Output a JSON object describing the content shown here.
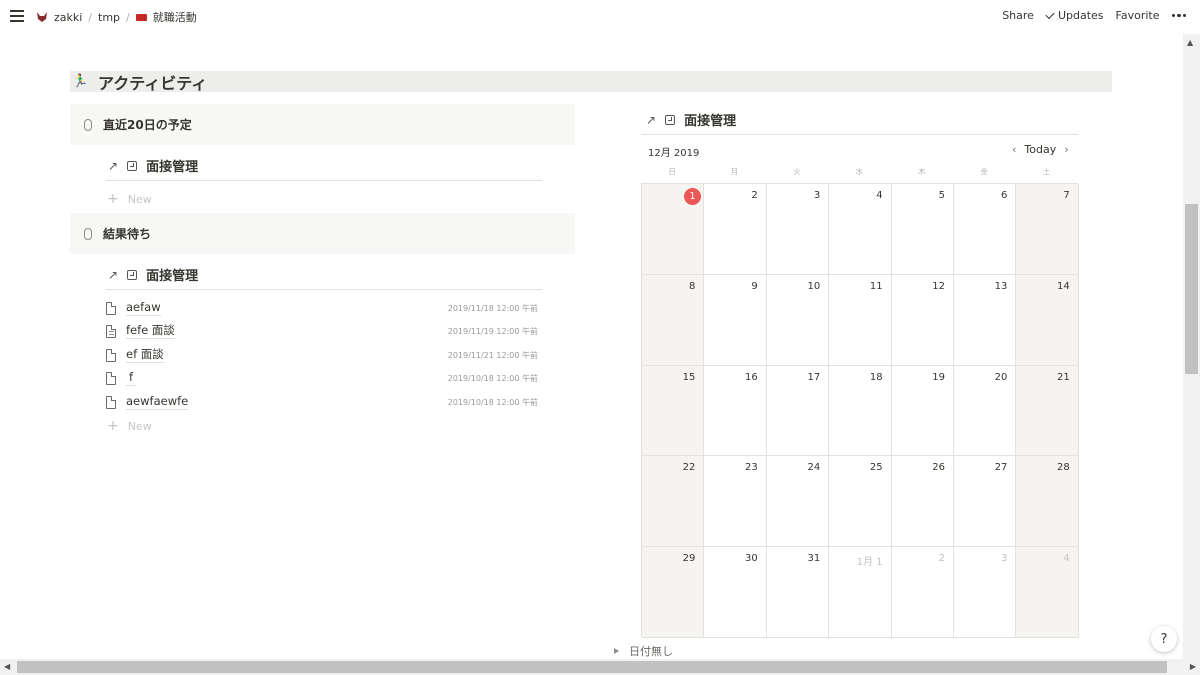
{
  "topbar": {
    "crumbs": [
      "zakki",
      "tmp",
      "就職活動"
    ],
    "separator": "/",
    "share": "Share",
    "updates": "Updates",
    "favorite": "Favorite"
  },
  "section": {
    "title": "アクティビティ",
    "icon": "🏃‍♂"
  },
  "left": {
    "toggles": [
      {
        "title": "直近20日の予定",
        "view_title": "面接管理",
        "new_label": "New"
      },
      {
        "title": "結果待ち",
        "view_title": "面接管理",
        "new_label": "New",
        "items": [
          {
            "title": "aefaw",
            "date": "2019/11/18 12:00 午前"
          },
          {
            "title": "fefe 面談",
            "date": "2019/11/19 12:00 午前"
          },
          {
            "title": "ef 面談",
            "date": "2019/11/21 12:00 午前"
          },
          {
            "title": "f",
            "date": "2019/10/18 12:00 午前"
          },
          {
            "title": "aewfaewfe",
            "date": "2019/10/18 12:00 午前"
          }
        ]
      }
    ]
  },
  "calendar": {
    "title": "面接管理",
    "month": "12月 2019",
    "today_label": "Today",
    "prev": "‹",
    "next": "›",
    "weekdays": [
      "日",
      "月",
      "火",
      "水",
      "木",
      "金",
      "土"
    ],
    "days": [
      "1",
      "2",
      "3",
      "4",
      "5",
      "6",
      "7",
      "8",
      "9",
      "10",
      "11",
      "12",
      "13",
      "14",
      "15",
      "16",
      "17",
      "18",
      "19",
      "20",
      "21",
      "22",
      "23",
      "24",
      "25",
      "26",
      "27",
      "28",
      "29",
      "30",
      "31",
      "1月 1",
      "2",
      "3",
      "4"
    ],
    "today_day": "1",
    "accent": "#eb5757"
  },
  "no_date_label": "日付無し",
  "help_label": "?"
}
